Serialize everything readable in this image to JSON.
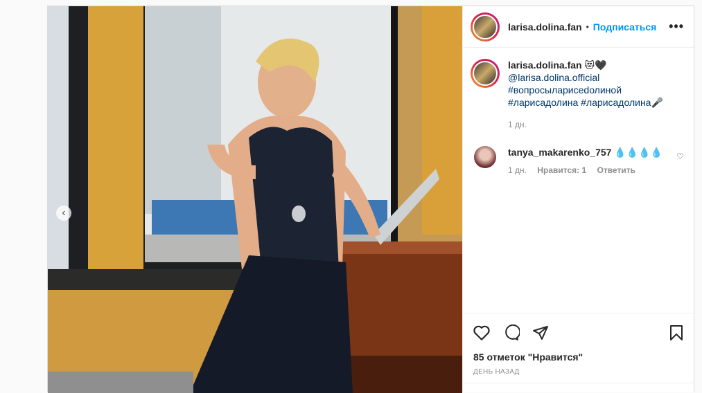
{
  "header": {
    "username": "larisa.dolina.fan",
    "separator": "•",
    "follow_label": "Подписаться",
    "more_icon": "more-horizontal-icon"
  },
  "caption": {
    "username": "larisa.dolina.fan",
    "emoji": "😻🖤",
    "mention": "@larisa.dolina.official",
    "hashtag1": "#вопросыларисеdолиной",
    "hashtag2_line": "#ларисадолина #ларисадолина🎤",
    "time": "1 дн."
  },
  "comment": {
    "username": "tanya_makarenko_757",
    "text": "💧💧💧💧",
    "time": "1 дн.",
    "likes": "Нравится: 1",
    "reply_label": "Ответить"
  },
  "actions": {
    "like_icon": "heart-outline-icon",
    "comment_icon": "comment-bubble-icon",
    "share_icon": "paper-plane-icon",
    "save_icon": "bookmark-icon"
  },
  "likes_text": "85 отметок \"Нравится\"",
  "posted": "день назад",
  "media": {
    "prev_icon": "chevron-left-icon",
    "prev_label": "‹"
  }
}
